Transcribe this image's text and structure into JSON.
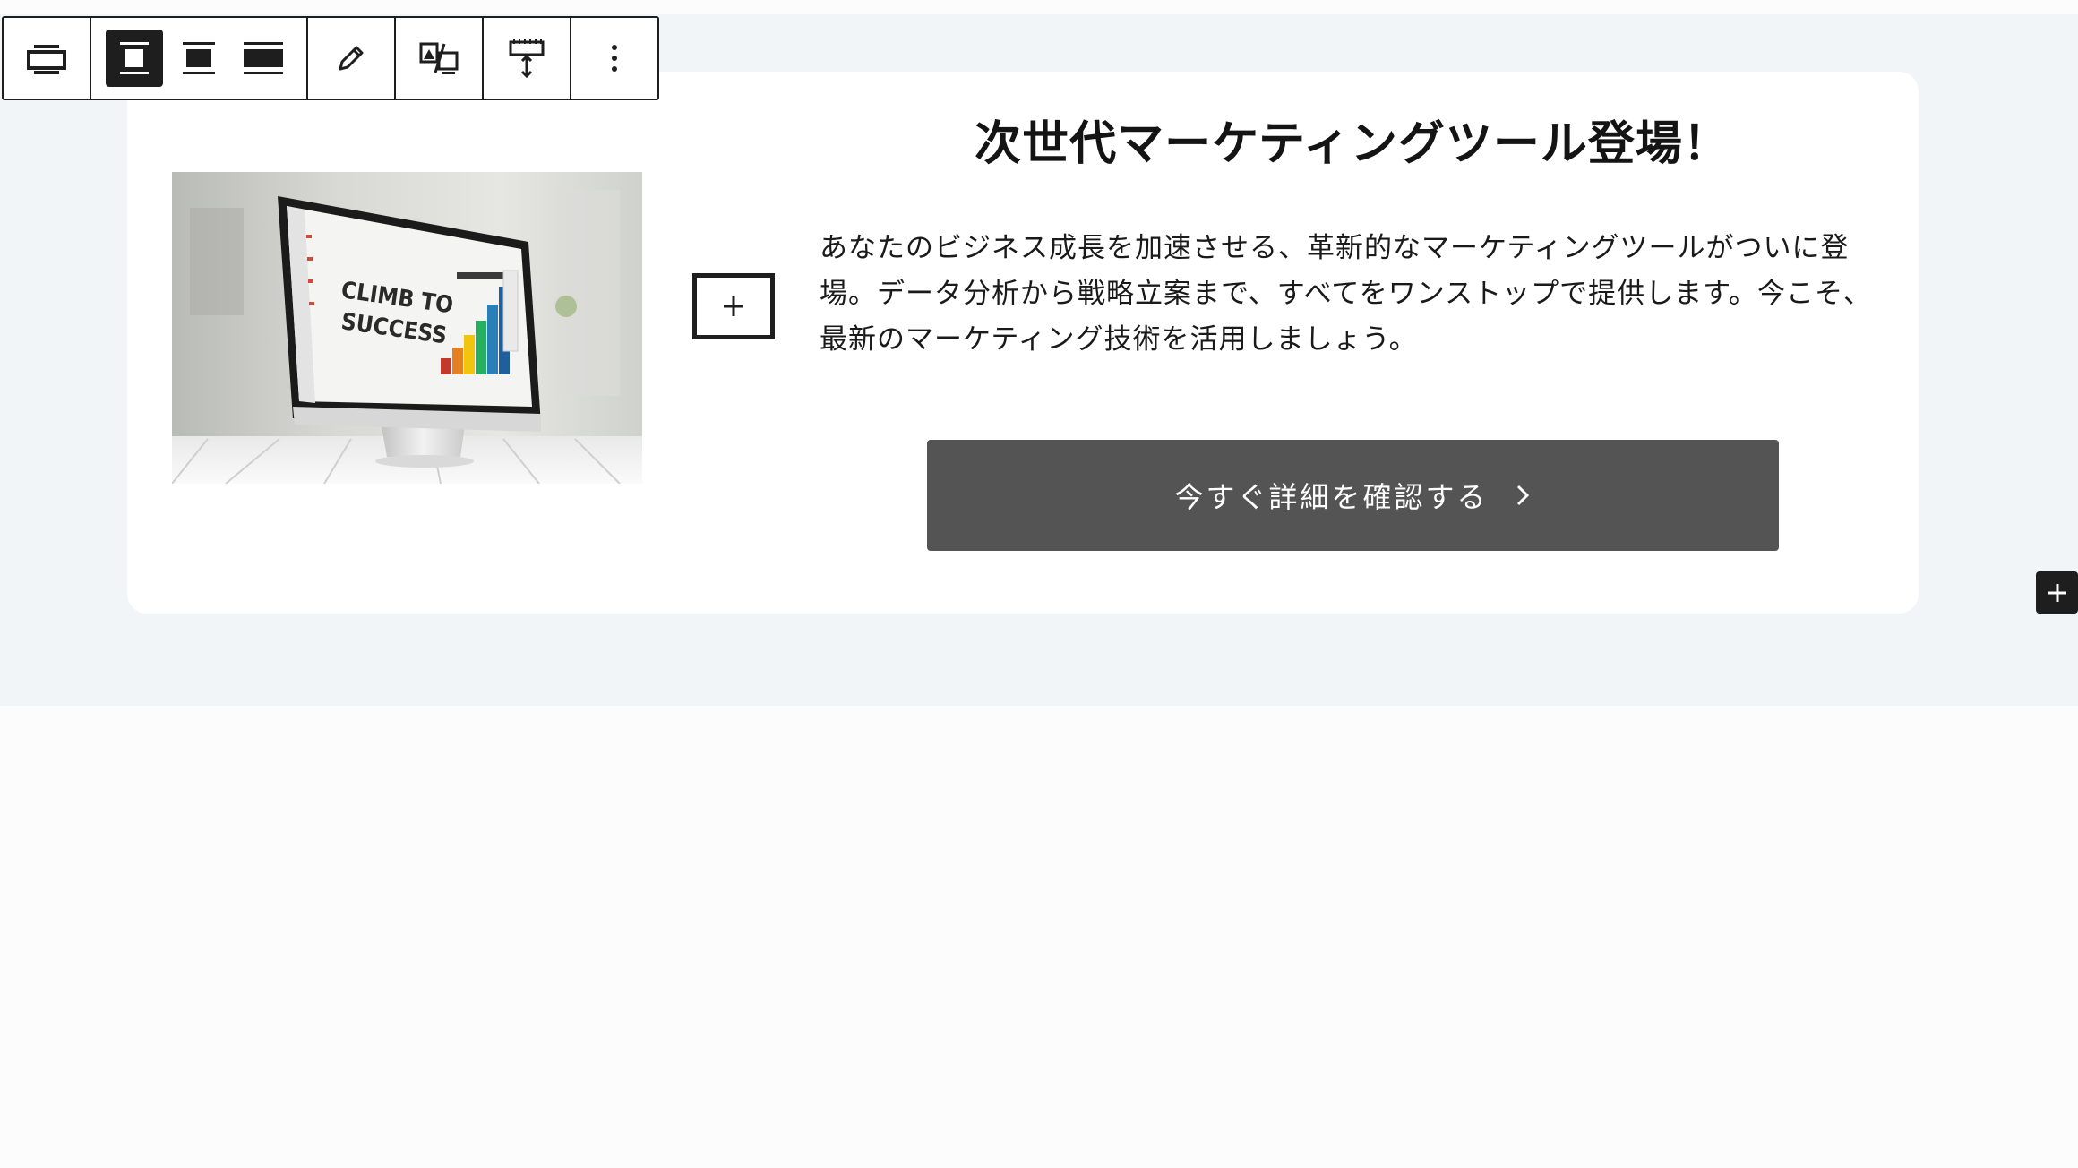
{
  "toolbar": {
    "buttons": [
      {
        "name": "block-type-icon",
        "label": "Cover"
      },
      {
        "name": "align-none-icon",
        "label": "None"
      },
      {
        "name": "align-wide-icon",
        "label": "Wide width"
      },
      {
        "name": "align-full-icon",
        "label": "Full width"
      },
      {
        "name": "edit-pencil-icon",
        "label": "Edit"
      },
      {
        "name": "replace-media-icon",
        "label": "Replace"
      },
      {
        "name": "change-position-icon",
        "label": "Change content position"
      },
      {
        "name": "more-options-icon",
        "label": "Options"
      }
    ],
    "active": "align-none-icon"
  },
  "image": {
    "screen_text_line1": "CLIMB TO",
    "screen_text_line2": "SUCCESS"
  },
  "content": {
    "heading": "次世代マーケティングツール登場！",
    "body": "あなたのビジネス成長を加速させる、革新的なマーケティングツールがついに登場。データ分析から戦略立案まで、すべてをワンストップで提供します。今こそ、最新のマーケティング技術を活用しましょう。",
    "cta_label": "今すぐ詳細を確認する"
  },
  "colors": {
    "band_background": "#f1f5f8",
    "card_background": "#ffffff",
    "button_background": "#545454",
    "toolbar_dark": "#1e1e1e"
  }
}
